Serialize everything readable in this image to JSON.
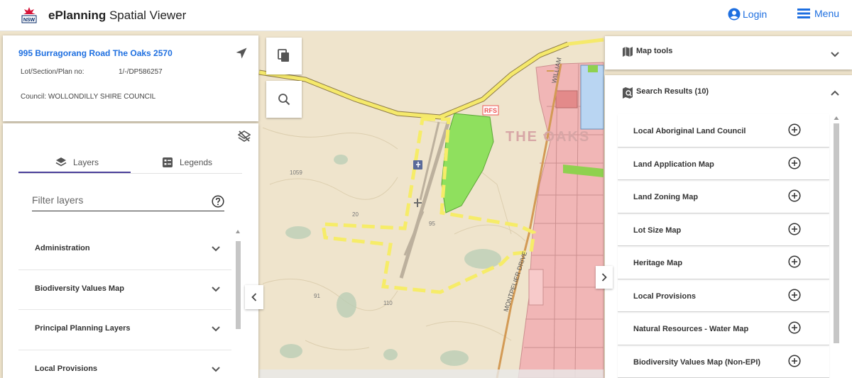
{
  "header": {
    "logo_label": "NSW",
    "app_title_bold": "ePlanning",
    "app_title_rest": " Spatial Viewer",
    "login_label": "Login",
    "menu_label": "Menu"
  },
  "address_card": {
    "address": "995 Burragorang Road The Oaks 2570",
    "lot_label": "Lot/Section/Plan no:",
    "lot_value": "1/-/DP586257",
    "council": "Council: WOLLONDILLY SHIRE COUNCIL"
  },
  "layers_panel": {
    "tab_layers": "Layers",
    "tab_legends": "Legends",
    "filter_placeholder": "Filter layers",
    "items": [
      {
        "label": "Administration"
      },
      {
        "label": "Biodiversity Values Map"
      },
      {
        "label": "Principal Planning Layers"
      },
      {
        "label": "Local Provisions"
      }
    ]
  },
  "map": {
    "labels": {
      "town": "THE OAKS",
      "road_william": "WILLIAM",
      "road_montpelier": "MONTPELIER DRIVE",
      "lot_1059": "1059",
      "lot_20": "20",
      "lot_91": "91",
      "lot_95": "95",
      "lot_110": "110",
      "rfs": "RFS"
    }
  },
  "right_panel": {
    "map_tools_label": "Map tools",
    "search_results_label": "Search Results (10)",
    "results": [
      {
        "label": "Local Aboriginal Land Council"
      },
      {
        "label": "Land Application Map"
      },
      {
        "label": "Land Zoning Map"
      },
      {
        "label": "Lot Size Map"
      },
      {
        "label": "Heritage Map"
      },
      {
        "label": "Local Provisions"
      },
      {
        "label": "Natural Resources - Water Map"
      },
      {
        "label": "Biodiversity Values Map (Non-EPI)"
      }
    ]
  }
}
